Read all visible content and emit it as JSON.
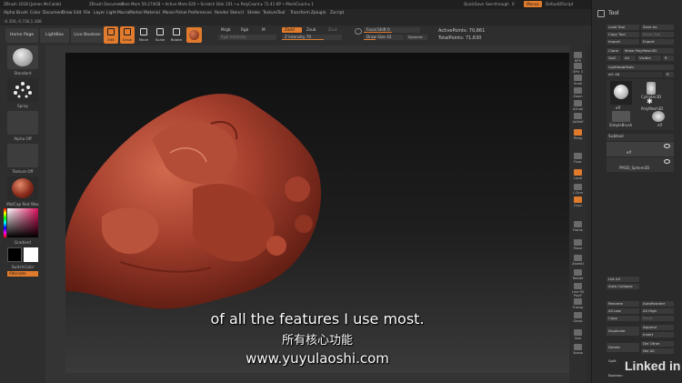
{
  "titlebar": {
    "app": "ZBrush 2018 [James McCaleb]",
    "doc": "ZBrush Document",
    "stats": "• Free Mem 59.274GB • Active Mem 620 • Scratch Disk 101 • ▸ PolyCount ▸ 72.41 KP • MeshCount ▸ 1",
    "quicksave": "QuickSave",
    "seethrough": "See-through",
    "seethrough_val": "0",
    "menus": "Menus",
    "script": "DefaultZScript"
  },
  "menubar": [
    "Alpha",
    "Brush",
    "Color",
    "Document",
    "Draw",
    "Edit",
    "File",
    "Layer",
    "Light",
    "Macro",
    "Marker",
    "Material",
    "Movie",
    "Picker",
    "Preferences",
    "Render",
    "Stencil",
    "Stroke",
    "Texture",
    "Tool",
    "Transform",
    "Zplugin",
    "Zscript"
  ],
  "infobar": "-0.356,-0.736,1.388",
  "shelf": {
    "home": "Home Page",
    "lightbox": "LightBox",
    "live_boolean": "Live Boolean",
    "tools": [
      "Edit",
      "Draw",
      "Move",
      "Scale",
      "Rotate"
    ],
    "mrgb": "Mrgb",
    "rgb": "Rgb",
    "m": "M",
    "rgb_intensity": "Rgb Intensity",
    "zadd": "Zadd",
    "zsub": "Zsub",
    "zcut": "Zcut",
    "z_intensity": "Z Intensity 70",
    "focal_shift": "Focal Shift 0",
    "draw_size": "Draw Size 42",
    "dynamic": "Dynamic",
    "active_points": "ActivePoints: 70,861",
    "total_points": "TotalPoints: 71,630"
  },
  "left": {
    "standard": "Standard",
    "spray": "Spray",
    "alpha_off": "Alpha Off",
    "texture_off": "Texture Off",
    "material": "MatCap Red Wax",
    "gradient": "Gradient",
    "switchcolor": "SwitchColor",
    "alternate": "Alternate"
  },
  "rightstrip": [
    "BPR",
    "SPix 3",
    "Scroll",
    "Zoom",
    "Actual",
    "AAHalf",
    "Persp",
    "Floor",
    "Local",
    "L.Sym",
    "Gxyz",
    "Frame",
    "Move",
    "ZoomD",
    "Rotate",
    "Line Fill PolyF",
    "Transp",
    "Ghost",
    "Solo",
    "Xpose"
  ],
  "panel": {
    "title": "Tool",
    "load_tool": "Load Tool",
    "save_as": "Save As",
    "copy_tool": "Copy Tool",
    "paste_tool": "Paste Tool",
    "import": "Import",
    "export": "Export",
    "clone": "Clone",
    "make_polymesh": "Make PolyMesh3D",
    "goz": "GoZ",
    "all": "All",
    "visible": "Visible",
    "r": "R",
    "lightbox_tools": "Lightbox▸Tools",
    "elf_label": "elf: 48",
    "elf_num": "R",
    "cylinder": "Cylinder3D",
    "polymesh": "PolyMesh3D",
    "simplebrush": "SimpleBrush",
    "elf_thumb": "elf",
    "elf_thumb2": "elf",
    "subtool": "Subtool",
    "st_elf": "elf",
    "st_sphere": "PM3D_Sphere3D",
    "list_all": "List All",
    "auto_collapse": "Auto Collapse",
    "rename": "Rename",
    "autoreorder": "AutoReorder",
    "all_low": "All Low",
    "all_high": "All High",
    "copy": "Copy",
    "paste": "Paste",
    "duplicate": "Duplicate",
    "append": "Append",
    "insert": "Insert",
    "delete": "Delete",
    "del_other": "Del Other",
    "del_all": "Del All",
    "split": "Split",
    "boolean": "Boolean"
  },
  "subtitle_en": "of all the features I use most.",
  "subtitle_cn": "所有核心功能",
  "watermark": "www.yuyulaoshi.com",
  "brand": "Linked in",
  "colors": {
    "accent": "#e07a2c",
    "clay": "#a8412f",
    "bg": "#2b2b2b"
  }
}
